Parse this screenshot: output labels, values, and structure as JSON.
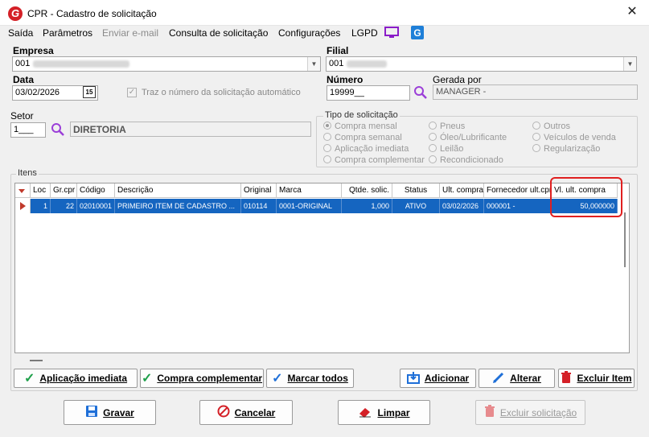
{
  "window": {
    "title": "CPR - Cadastro de solicitação",
    "close_glyph": "✕",
    "logo": "G"
  },
  "menu": [
    {
      "label": "Saída",
      "enabled": true
    },
    {
      "label": "Parâmetros",
      "enabled": true
    },
    {
      "label": "Enviar e-mail",
      "enabled": false
    },
    {
      "label": "Consulta de solicitação",
      "enabled": true
    },
    {
      "label": "Configurações",
      "enabled": true
    },
    {
      "label": "LGPD",
      "enabled": true
    }
  ],
  "empresa": {
    "label": "Empresa",
    "value": "001"
  },
  "filial": {
    "label": "Filial",
    "value": "001"
  },
  "data": {
    "label": "Data",
    "value": "03/02/2026",
    "cal_text": "15"
  },
  "auto_numero": {
    "label": "Traz o número da solicitação automático",
    "checked": true
  },
  "numero": {
    "label": "Número",
    "value": "19999__"
  },
  "gerada_por": {
    "label": "Gerada por",
    "value": "MANAGER -"
  },
  "setor": {
    "label": "Setor",
    "code": "1___",
    "description": "DIRETORIA"
  },
  "tipo": {
    "title": "Tipo de solicitação",
    "options": [
      {
        "label": "Compra mensal",
        "selected": true
      },
      {
        "label": "Compra semanal",
        "selected": false
      },
      {
        "label": "Aplicação imediata",
        "selected": false
      },
      {
        "label": "Compra complementar",
        "selected": false
      },
      {
        "label": "Pneus",
        "selected": false
      },
      {
        "label": "Óleo/Lubrificante",
        "selected": false
      },
      {
        "label": "Leilão",
        "selected": false
      },
      {
        "label": "Recondicionado",
        "selected": false
      },
      {
        "label": "Outros",
        "selected": false
      },
      {
        "label": "Veículos de venda",
        "selected": false
      },
      {
        "label": "Regularização",
        "selected": false
      }
    ]
  },
  "itens": {
    "title": "Itens",
    "columns": [
      "Loc",
      "Gr.cpr",
      "Código",
      "Descrição",
      "Original",
      "Marca",
      "Qtde. solic.",
      "Status",
      "Ult. compra",
      "Fornecedor ult.cpr",
      "Vl. ult. compra"
    ],
    "rows": [
      [
        "1",
        "22",
        "02010001",
        "PRIMEIRO ITEM DE CADASTRO ...",
        "010114",
        "0001-ORIGINAL",
        "1,000",
        "ATIVO",
        "03/02/2026",
        "000001 -",
        "50,000000"
      ]
    ],
    "highlight_color": "#e02020"
  },
  "buttons": {
    "aplicacao": "Aplicação imediata",
    "complementar": "Compra complementar",
    "marcar": "Marcar todos",
    "adicionar": "Adicionar",
    "alterar": "Alterar",
    "excluir_item": "Excluir Item",
    "gravar": "Gravar",
    "cancelar": "Cancelar",
    "limpar": "Limpar",
    "excluir_solicitacao": "Excluir solicitação"
  }
}
